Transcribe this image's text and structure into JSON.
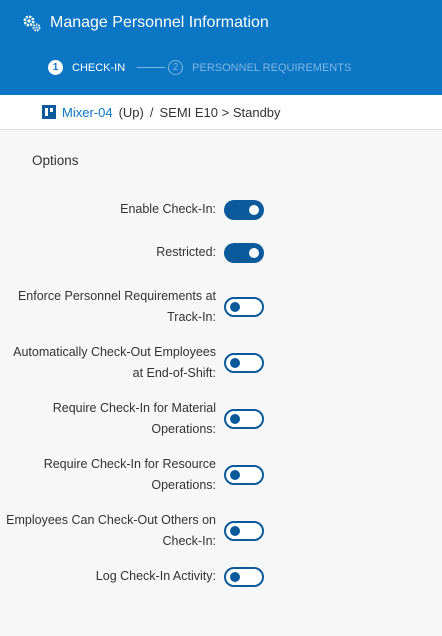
{
  "header": {
    "title": "Manage Personnel Information",
    "steps": [
      {
        "num": "1",
        "label": "CHECK-IN",
        "active": true
      },
      {
        "num": "2",
        "label": "PERSONNEL REQUIREMENTS",
        "active": false
      }
    ]
  },
  "breadcrumb": {
    "resource": "Mixer-04",
    "status": "(Up)",
    "separator": "/",
    "state": "SEMI E10 > Standby"
  },
  "options": {
    "title": "Options",
    "items": [
      {
        "label": "Enable Check-In:",
        "on": true
      },
      {
        "label": "Restricted:",
        "on": true
      },
      {
        "label": "Enforce Personnel Requirements at Track-In:",
        "on": false
      },
      {
        "label": "Automatically Check-Out Employees at End-of-Shift:",
        "on": false
      },
      {
        "label": "Require Check-In for Material Operations:",
        "on": false
      },
      {
        "label": "Require Check-In for Resource Operations:",
        "on": false
      },
      {
        "label": "Employees Can Check-Out Others on Check-In:",
        "on": false
      },
      {
        "label": "Log Check-In Activity:",
        "on": false
      }
    ]
  },
  "colors": {
    "header": "#0a76c4",
    "toggle": "#0a5a9c"
  }
}
